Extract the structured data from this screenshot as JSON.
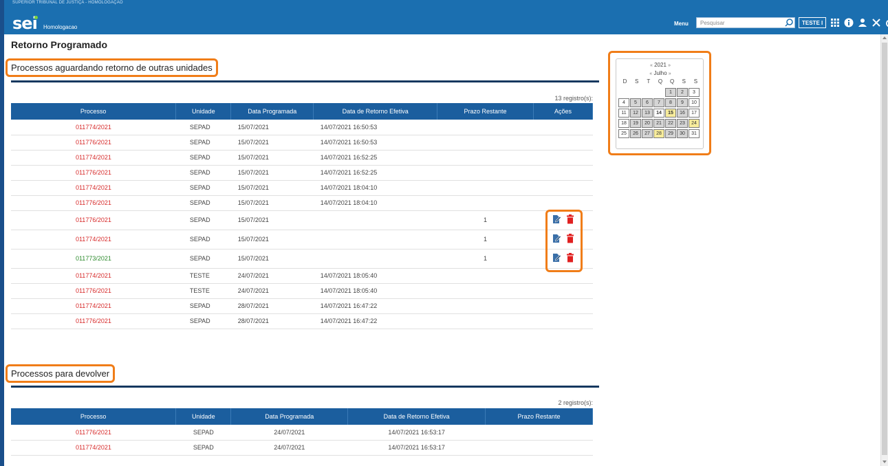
{
  "header": {
    "org": "SUPERIOR TRIBUNAL DE JUSTIÇA - HOMOLOGAÇÃO",
    "logo": "sei",
    "env": "Homologacao",
    "menu_label": "Menu",
    "search_placeholder": "Pesquisar",
    "user_label": "TESTE I",
    "icons": [
      "grid-icon",
      "info-icon",
      "user-icon",
      "tools-icon",
      "power-icon"
    ]
  },
  "page_title": "Retorno Programado",
  "section1": {
    "title": "Processos aguardando retorno de outras unidades",
    "count": "13 registro(s):",
    "headers": [
      "Processo",
      "Unidade",
      "Data Programada",
      "Data de Retorno Efetiva",
      "Prazo Restante",
      "Ações"
    ],
    "rows": [
      {
        "processo": "011774/2021",
        "unidade": "SEPAD",
        "data_prog": "15/07/2021",
        "data_ret": "14/07/2021 16:50:53",
        "prazo": "",
        "color": "red",
        "actions": false
      },
      {
        "processo": "011776/2021",
        "unidade": "SEPAD",
        "data_prog": "15/07/2021",
        "data_ret": "14/07/2021 16:50:53",
        "prazo": "",
        "color": "red",
        "actions": false
      },
      {
        "processo": "011774/2021",
        "unidade": "SEPAD",
        "data_prog": "15/07/2021",
        "data_ret": "14/07/2021 16:52:25",
        "prazo": "",
        "color": "red",
        "actions": false
      },
      {
        "processo": "011776/2021",
        "unidade": "SEPAD",
        "data_prog": "15/07/2021",
        "data_ret": "14/07/2021 16:52:25",
        "prazo": "",
        "color": "red",
        "actions": false
      },
      {
        "processo": "011774/2021",
        "unidade": "SEPAD",
        "data_prog": "15/07/2021",
        "data_ret": "14/07/2021 18:04:10",
        "prazo": "",
        "color": "red",
        "actions": false
      },
      {
        "processo": "011776/2021",
        "unidade": "SEPAD",
        "data_prog": "15/07/2021",
        "data_ret": "14/07/2021 18:04:10",
        "prazo": "",
        "color": "red",
        "actions": false
      },
      {
        "processo": "011776/2021",
        "unidade": "SEPAD",
        "data_prog": "15/07/2021",
        "data_ret": "",
        "prazo": "1",
        "color": "red",
        "actions": true
      },
      {
        "processo": "011774/2021",
        "unidade": "SEPAD",
        "data_prog": "15/07/2021",
        "data_ret": "",
        "prazo": "1",
        "color": "red",
        "actions": true
      },
      {
        "processo": "011773/2021",
        "unidade": "SEPAD",
        "data_prog": "15/07/2021",
        "data_ret": "",
        "prazo": "1",
        "color": "green",
        "actions": true
      },
      {
        "processo": "011774/2021",
        "unidade": "TESTE",
        "data_prog": "24/07/2021",
        "data_ret": "14/07/2021 18:05:40",
        "prazo": "",
        "color": "red",
        "actions": false
      },
      {
        "processo": "011776/2021",
        "unidade": "TESTE",
        "data_prog": "24/07/2021",
        "data_ret": "14/07/2021 18:05:40",
        "prazo": "",
        "color": "red",
        "actions": false
      },
      {
        "processo": "011774/2021",
        "unidade": "SEPAD",
        "data_prog": "28/07/2021",
        "data_ret": "14/07/2021 16:47:22",
        "prazo": "",
        "color": "red",
        "actions": false
      },
      {
        "processo": "011776/2021",
        "unidade": "SEPAD",
        "data_prog": "28/07/2021",
        "data_ret": "14/07/2021 16:47:22",
        "prazo": "",
        "color": "red",
        "actions": false
      }
    ]
  },
  "section2": {
    "title": "Processos para devolver",
    "count": "2 registro(s):",
    "headers": [
      "Processo",
      "Unidade",
      "Data Programada",
      "Data de Retorno Efetiva",
      "Prazo Restante"
    ],
    "rows": [
      {
        "processo": "011776/2021",
        "unidade": "SEPAD",
        "data_prog": "24/07/2021",
        "data_ret": "14/07/2021 16:53:17",
        "prazo": ""
      },
      {
        "processo": "011774/2021",
        "unidade": "SEPAD",
        "data_prog": "24/07/2021",
        "data_ret": "14/07/2021 16:53:17",
        "prazo": ""
      }
    ]
  },
  "calendar": {
    "year": "2021",
    "month": "Julho",
    "prev": "«",
    "next": "»",
    "dow": [
      "D",
      "S",
      "T",
      "Q",
      "Q",
      "S",
      "S"
    ],
    "days": [
      {
        "d": "",
        "s": "empty"
      },
      {
        "d": "",
        "s": "empty"
      },
      {
        "d": "",
        "s": "empty"
      },
      {
        "d": "",
        "s": "empty"
      },
      {
        "d": "1",
        "s": "gray"
      },
      {
        "d": "2",
        "s": "gray"
      },
      {
        "d": "3",
        "s": "white"
      },
      {
        "d": "4",
        "s": "white"
      },
      {
        "d": "5",
        "s": "gray"
      },
      {
        "d": "6",
        "s": "gray"
      },
      {
        "d": "7",
        "s": "gray"
      },
      {
        "d": "8",
        "s": "gray"
      },
      {
        "d": "9",
        "s": "gray"
      },
      {
        "d": "10",
        "s": "white"
      },
      {
        "d": "11",
        "s": "white"
      },
      {
        "d": "12",
        "s": "gray"
      },
      {
        "d": "13",
        "s": "gray"
      },
      {
        "d": "14",
        "s": "white bold"
      },
      {
        "d": "15",
        "s": "yellow bold"
      },
      {
        "d": "16",
        "s": "gray"
      },
      {
        "d": "17",
        "s": "white"
      },
      {
        "d": "18",
        "s": "white"
      },
      {
        "d": "19",
        "s": "gray"
      },
      {
        "d": "20",
        "s": "gray"
      },
      {
        "d": "21",
        "s": "gray"
      },
      {
        "d": "22",
        "s": "gray"
      },
      {
        "d": "23",
        "s": "gray"
      },
      {
        "d": "24",
        "s": "yellow"
      },
      {
        "d": "25",
        "s": "white"
      },
      {
        "d": "26",
        "s": "gray"
      },
      {
        "d": "27",
        "s": "gray"
      },
      {
        "d": "28",
        "s": "yellow"
      },
      {
        "d": "29",
        "s": "gray"
      },
      {
        "d": "30",
        "s": "gray"
      },
      {
        "d": "31",
        "s": "white"
      }
    ]
  },
  "colors": {
    "topbar": "#1b6fb0",
    "table_header": "#1b5e9e",
    "highlight": "#f07d18",
    "process_red": "#d72a2a",
    "process_green": "#2e8b2e",
    "delete_red": "#e02020"
  }
}
